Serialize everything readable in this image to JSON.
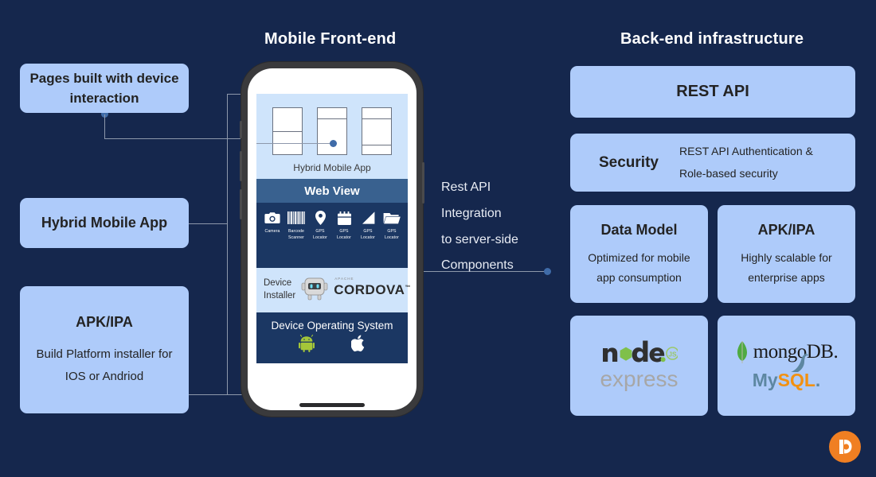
{
  "headings": {
    "mobile": "Mobile Front-end",
    "backend": "Back-end infrastructure"
  },
  "left_column": [
    {
      "title": "Pages built with device interaction",
      "body": ""
    },
    {
      "title": "Hybrid Mobile App",
      "body": ""
    },
    {
      "title": "APK/IPA",
      "body": "Build Platform installer for IOS or Andriod"
    }
  ],
  "middle_note": {
    "line1": "Rest API",
    "line2": "Integration",
    "line3": "to server-side",
    "line4": "Components"
  },
  "phone": {
    "wireframe_label": "Hybrid Mobile App",
    "webview_label": "Web View",
    "native_icons": [
      {
        "icon": "camera-icon",
        "label": "Camera"
      },
      {
        "icon": "barcode-icon",
        "label": "Barcode Scanner"
      },
      {
        "icon": "map-pin-icon",
        "label": "GPS Locator"
      },
      {
        "icon": "calendar-icon",
        "label": "GPS Locator"
      },
      {
        "icon": "signal-icon",
        "label": "GPS Locator"
      },
      {
        "icon": "folder-icon",
        "label": "GPS Locator"
      }
    ],
    "device_installer": {
      "label_line1": "Device",
      "label_line2": "Installer",
      "brand_small": "APACHE",
      "brand": "CORDOVA",
      "brand_tm": "™"
    },
    "os_section": {
      "title": "Device Operating System",
      "icons": [
        "android-icon",
        "apple-icon"
      ]
    }
  },
  "backend": {
    "rest_api": {
      "title": "REST API"
    },
    "security": {
      "title": "Security",
      "body_line1": "REST API Authentication &",
      "body_line2": "Role-based security"
    },
    "data_model": {
      "title": "Data Model",
      "body_line1": "Optimized for mobile",
      "body_line2": "app consumption"
    },
    "apk_ipa": {
      "title": "APK/IPA",
      "body_line1": "Highly scalable for",
      "body_line2": "enterprise apps"
    },
    "stack_left": {
      "logo1": "nodejs-logo",
      "logo2": "express-logo",
      "text": "express"
    },
    "stack_right": {
      "logo1": "mongodb-logo",
      "text1": "mongoDB.",
      "logo2": "mysql-logo",
      "text2": "MySQL"
    }
  },
  "logo": {
    "name": "brand-logo",
    "letter": "b"
  },
  "colors": {
    "background": "#15274d",
    "card": "#aecbfa",
    "webview_bar": "#39618f",
    "native_panel": "#1b3763",
    "wireframe_panel": "#cfe4fb",
    "connector": "#8d98ab",
    "dot": "#3f6ba8",
    "brand_orange": "#f07f22",
    "android_green": "#a4c639"
  }
}
